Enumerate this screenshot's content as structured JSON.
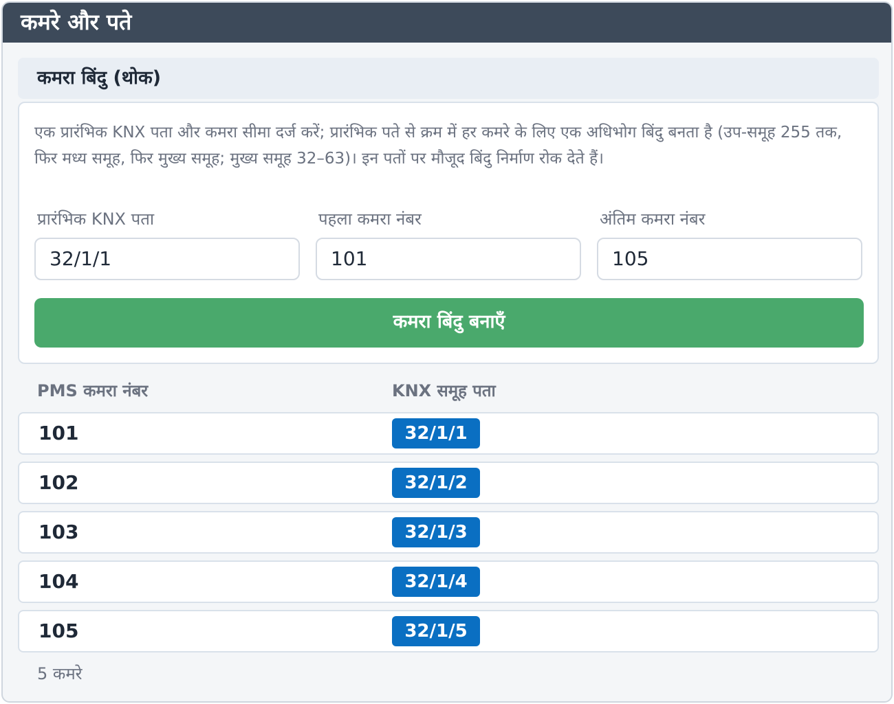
{
  "window": {
    "title": "कमरे और पते"
  },
  "section": {
    "title": "कमरा बिंदु (थोक)"
  },
  "form": {
    "description": "एक प्रारंभिक KNX पता और कमरा सीमा दर्ज करें; प्रारंभिक पते से क्रम में हर कमरे के लिए एक अधिभोग बिंदु बनता है (उप-समूह 255 तक, फिर मध्य समूह, फिर मुख्य समूह; मुख्य समूह 32–63)। इन पतों पर मौजूद बिंदु निर्माण रोक देते हैं।",
    "fields": [
      {
        "label": "प्रारंभिक KNX पता",
        "value": "32/1/1"
      },
      {
        "label": "पहला कमरा नंबर",
        "value": "101"
      },
      {
        "label": "अंतिम कमरा नंबर",
        "value": "105"
      }
    ],
    "submit_label": "कमरा बिंदु बनाएँ"
  },
  "table": {
    "columns": [
      "PMS कमरा नंबर",
      "KNX समूह पता"
    ],
    "rows": [
      {
        "room": "101",
        "address": "32/1/1"
      },
      {
        "room": "102",
        "address": "32/1/2"
      },
      {
        "room": "103",
        "address": "32/1/3"
      },
      {
        "room": "104",
        "address": "32/1/4"
      },
      {
        "room": "105",
        "address": "32/1/5"
      }
    ]
  },
  "summary": {
    "count_label": "5 कमरे"
  },
  "colors": {
    "titlebar": "#3d4a5a",
    "primary_button": "#4aa96c",
    "address_badge": "#0a6fc2"
  }
}
